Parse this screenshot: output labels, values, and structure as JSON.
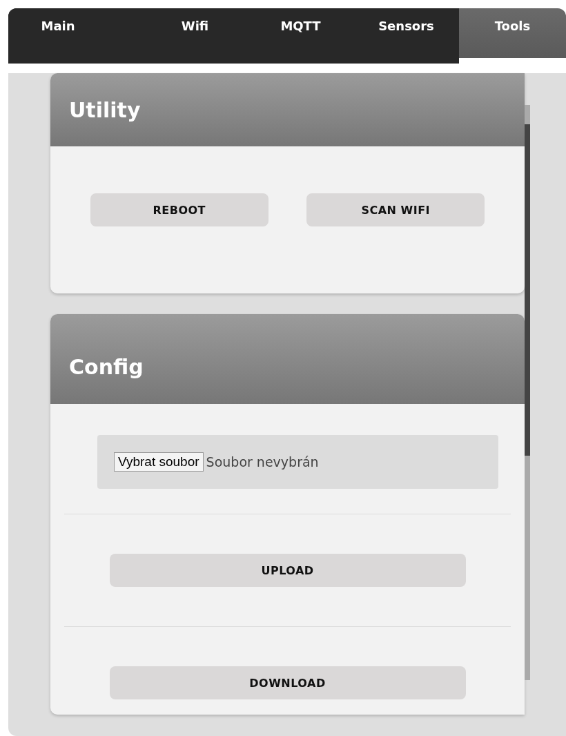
{
  "tabs": [
    {
      "label": "Main",
      "selected": false
    },
    {
      "label": "Wifi",
      "selected": false
    },
    {
      "label": "MQTT",
      "selected": false
    },
    {
      "label": "Sensors",
      "selected": false
    },
    {
      "label": "Tools",
      "selected": true
    }
  ],
  "sections": [
    {
      "title": "Utility",
      "kind": "utility",
      "items": [
        {
          "kind": "button_row",
          "buttons": [
            "REBOOT",
            "SCAN WIFI"
          ]
        }
      ]
    },
    {
      "title": "Config",
      "kind": "config",
      "items": [
        {
          "kind": "file",
          "button": "Vybrat soubor",
          "status": "Soubor nevybrán"
        },
        {
          "kind": "button",
          "label": "UPLOAD"
        },
        {
          "kind": "button",
          "label": "DOWNLOAD"
        }
      ]
    }
  ]
}
